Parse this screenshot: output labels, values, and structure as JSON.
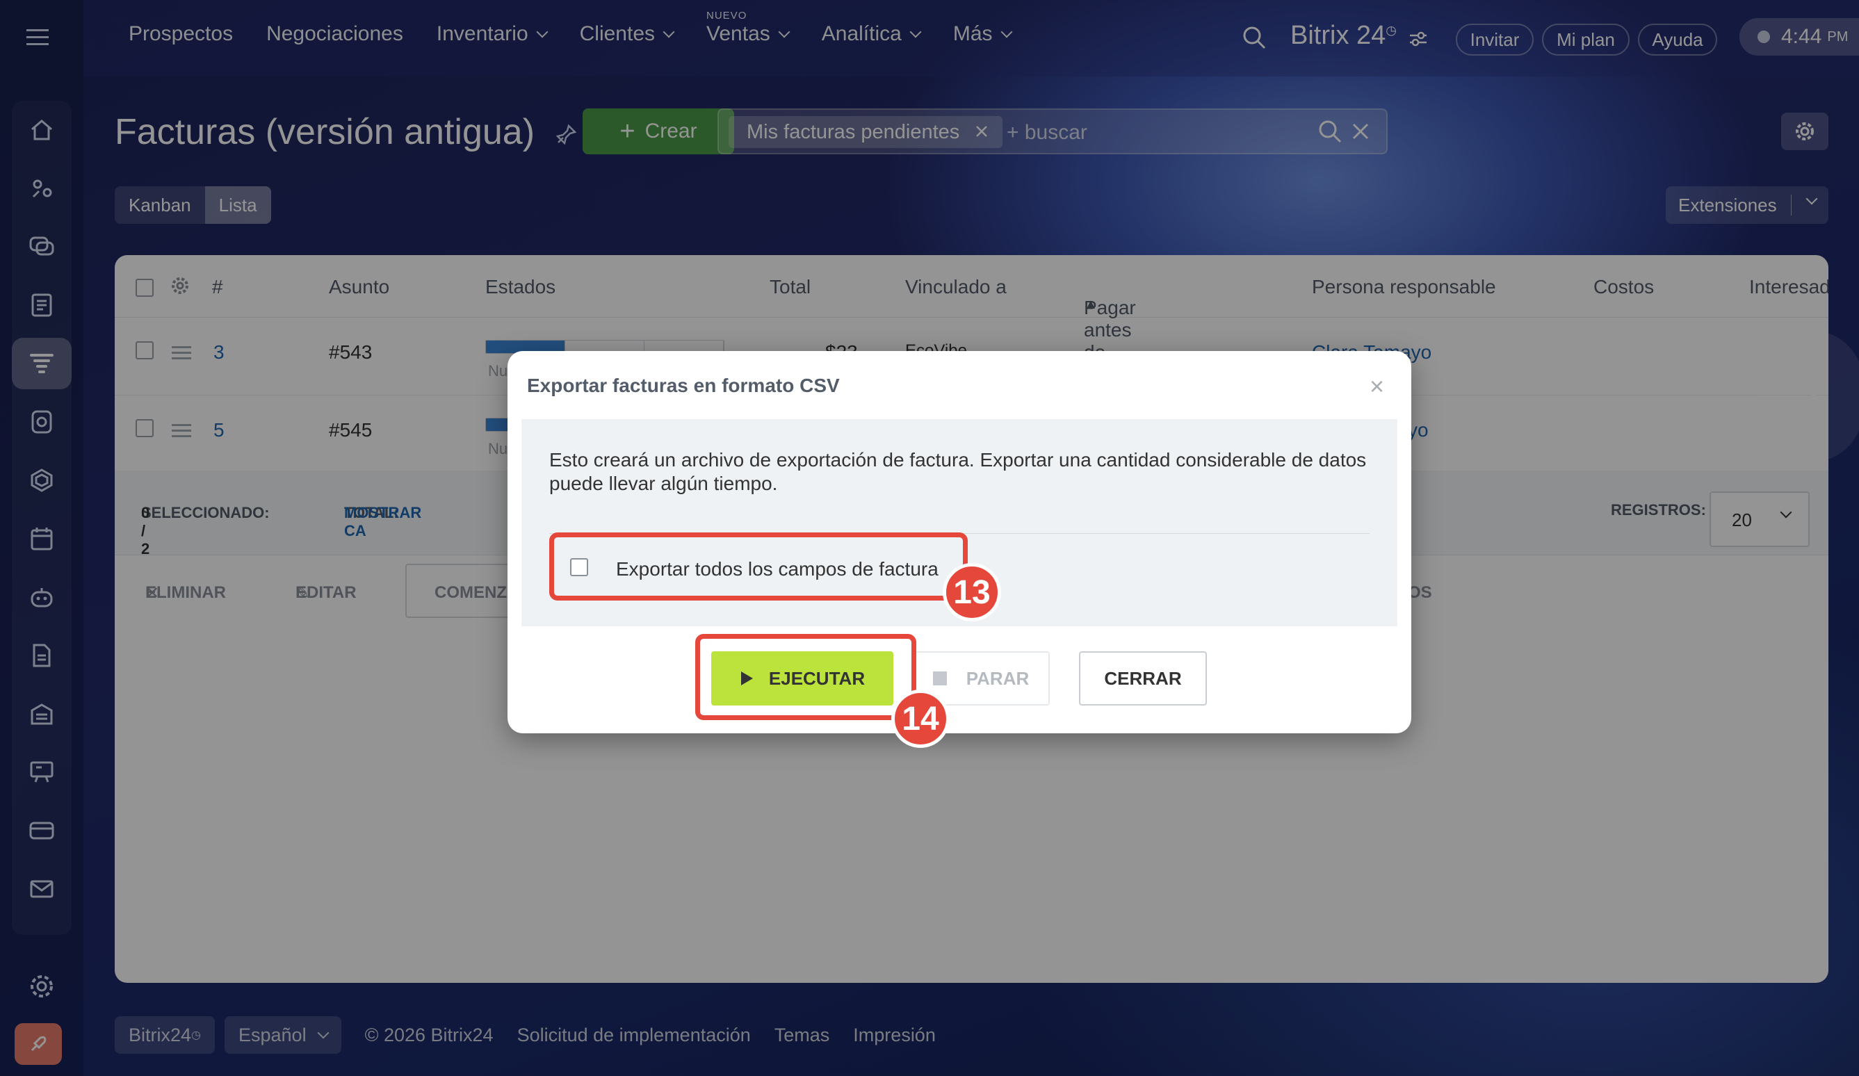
{
  "topnav": {
    "items": [
      {
        "label": "Prospectos",
        "dropdown": false
      },
      {
        "label": "Negociaciones",
        "dropdown": false
      },
      {
        "label": "Inventario",
        "dropdown": true
      },
      {
        "label": "Clientes",
        "dropdown": true
      },
      {
        "label": "Ventas",
        "dropdown": true,
        "badge": "NUEVO"
      },
      {
        "label": "Analítica",
        "dropdown": true
      },
      {
        "label": "Más",
        "dropdown": true
      }
    ],
    "brand": "Bitrix 24",
    "invite": "Invitar",
    "plan": "Mi plan",
    "help": "Ayuda",
    "time": "4:44",
    "time_suffix": "PM"
  },
  "page": {
    "title": "Facturas (versión antigua)",
    "create_label": "Crear",
    "filter_chip": "Mis facturas pendientes",
    "search_placeholder": "+ buscar",
    "view_kanban": "Kanban",
    "view_list": "Lista",
    "extensions": "Extensiones"
  },
  "grid": {
    "columns": {
      "num": "#",
      "subject": "Asunto",
      "status": "Estados",
      "total": "Total",
      "linked": "Vinculado a",
      "pay_before": "Pagar antes de",
      "responsible": "Persona responsable",
      "costs": "Costos",
      "interested": "Interesad"
    },
    "rows": [
      {
        "id": "3",
        "subject": "#543",
        "total": "$23",
        "linked": "EcoVibe",
        "responsible": "Clara Tamayo",
        "status_abbr": "Nu",
        "stage_filled": 1
      },
      {
        "id": "5",
        "subject": "#545",
        "total": "",
        "linked": "",
        "responsible": "yo",
        "status_abbr": "Nu",
        "stage_filled": 1
      }
    ],
    "selected_label": "SELECCIONADO:",
    "selected_value": "0 / 2",
    "total_label": "TOTAL:",
    "total_value": "MOSTRAR CA",
    "records_label": "REGISTROS:",
    "records_value": "20",
    "delete_label": "ELIMINAR",
    "edit_label": "EDITAR",
    "start_label": "COMENZ",
    "extra_label": "OS"
  },
  "footer": {
    "brand": "Bitrix24",
    "language": "Español",
    "copyright": "© 2026 Bitrix24",
    "impl": "Solicitud de implementación",
    "themes": "Temas",
    "print": "Impresión"
  },
  "dialog": {
    "title": "Exportar facturas en formato CSV",
    "text": "Esto creará un archivo de exportación de factura. Exportar una cantidad considerable de datos puede llevar algún tiempo.",
    "checkbox_label": "Exportar todos los campos de factura",
    "run": "EJECUTAR",
    "stop": "PARAR",
    "close": "CERRAR",
    "step_a": "13",
    "step_b": "14"
  },
  "colors": {
    "accent_green": "#bce23c",
    "create_green": "#4a9a47",
    "highlight_red": "#e5473a",
    "link_blue": "#2067b0"
  },
  "icons": [
    "menu-icon",
    "home-icon",
    "crm-icon",
    "chat-icon",
    "tasks-icon",
    "filter-icon",
    "sites-icon",
    "market-icon",
    "calendar-icon",
    "robot-icon",
    "docs-icon",
    "store-icon",
    "training-icon",
    "payment-icon",
    "mail-icon",
    "settings-icon",
    "rocket-icon"
  ]
}
